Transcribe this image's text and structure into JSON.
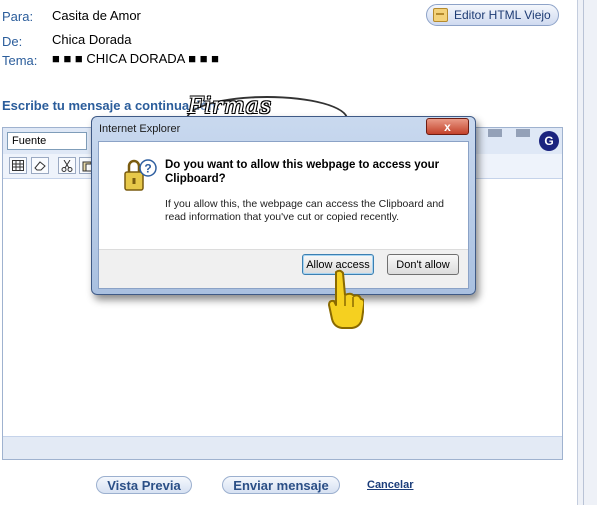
{
  "header": {
    "to_label": "Para:",
    "to_value": "Casita de Amor",
    "from_label": "De:",
    "from_value": "Chica Dorada",
    "subject_label": "Tema:",
    "subject_value": "■ ■ ■ CHICA DORADA ■ ■ ■",
    "editor_button": "Editor HTML Viejo"
  },
  "compose": {
    "prompt_label": "Escribe tu mensaje a continuación:",
    "font_select": "Fuente",
    "g_button": "G"
  },
  "watermark": {
    "text": "Firmas Chica"
  },
  "dialog": {
    "title": "Internet Explorer",
    "close": "x",
    "heading": "Do you want to allow this webpage to access your Clipboard?",
    "body": "If you allow this, the webpage can access the Clipboard and read information that you've cut or copied recently.",
    "allow_button": "Allow access",
    "deny_button": "Don't allow"
  },
  "footer": {
    "preview_button": "Vista Previa",
    "send_button": "Enviar mensaje",
    "cancel_link": "Cancelar"
  },
  "icons": [
    "editor-html-icon",
    "table-icon",
    "eraser-icon",
    "cut-icon",
    "paste-icon",
    "security-lock-icon",
    "pointing-hand-icon"
  ],
  "colors": {
    "label_blue": "#2b5d9b",
    "dialog_frame": "#a9c0e0",
    "close_red": "#c3412b",
    "g_button": "#1a237e"
  }
}
